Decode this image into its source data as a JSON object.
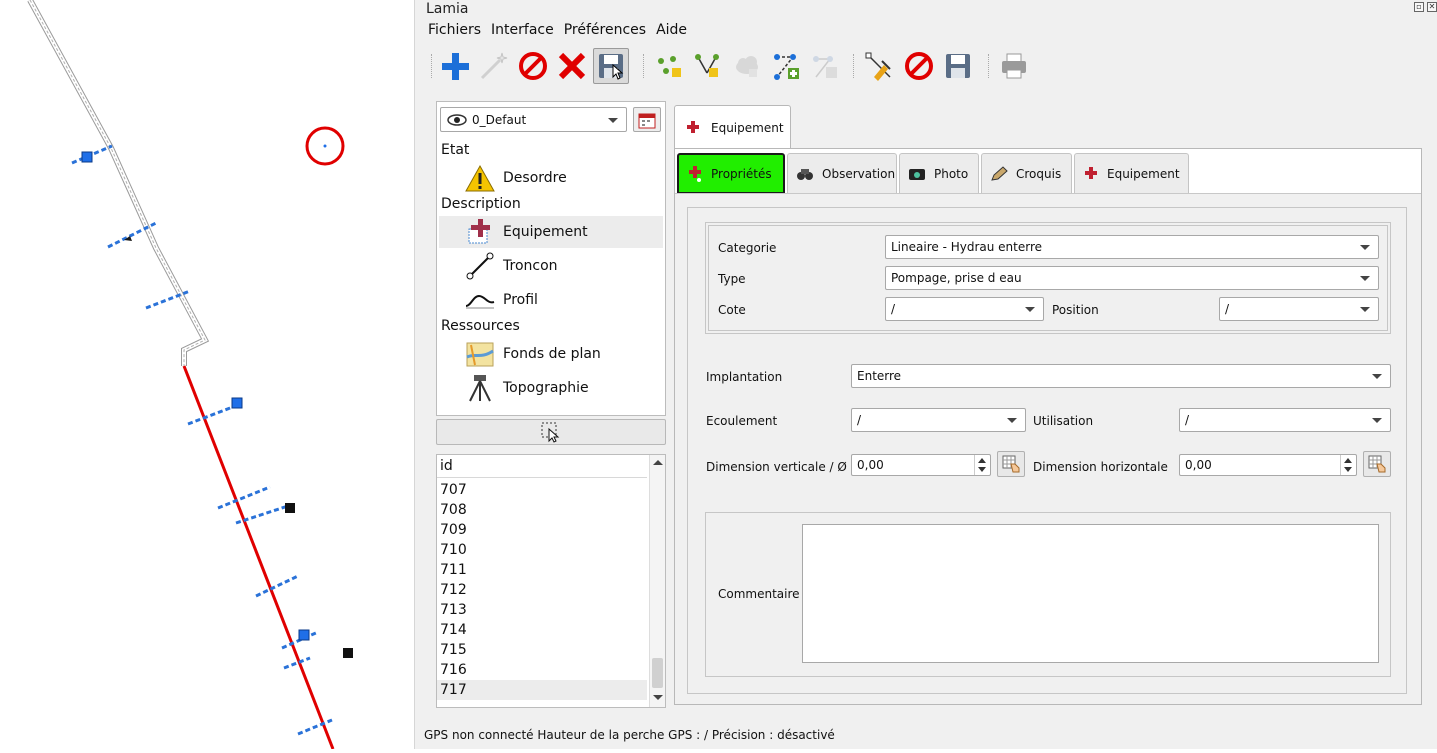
{
  "window": {
    "title": "Lamia"
  },
  "menu": [
    "Fichiers",
    "Interface",
    "Préférences",
    "Aide"
  ],
  "toolbar": {
    "icons": [
      "add-icon",
      "magic-wand-icon",
      "cancel-icon",
      "delete-icon",
      "save-icon",
      "add-node-icon",
      "edit-node-icon",
      "cloud-icon",
      "add-line-node-icon",
      "line-graph-icon",
      "edit-geometry-icon",
      "cancel-icon",
      "save-icon",
      "print-icon"
    ]
  },
  "left": {
    "version_combo": "0_Defaut",
    "tree": {
      "etat": "Etat",
      "desordre": "Desordre",
      "description": "Description",
      "equipement": "Equipement",
      "troncon": "Troncon",
      "profil": "Profil",
      "ressources": "Ressources",
      "fonds_de_plan": "Fonds de plan",
      "topographie": "Topographie"
    },
    "list": {
      "header": "id",
      "rows": [
        "707",
        "708",
        "709",
        "710",
        "711",
        "712",
        "713",
        "714",
        "715",
        "716",
        "717"
      ]
    }
  },
  "form": {
    "outer_tab": "Equipement",
    "tabs": {
      "proprietes": "Propriétés",
      "observation": "Observation",
      "photo": "Photo",
      "croquis": "Croquis",
      "equipement": "Equipement"
    },
    "labels": {
      "categorie": "Categorie",
      "type": "Type",
      "cote": "Cote",
      "position": "Position",
      "implantation": "Implantation",
      "ecoulement": "Ecoulement",
      "utilisation": "Utilisation",
      "dim_v": "Dimension verticale / Ø",
      "dim_h": "Dimension horizontale",
      "commentaire": "Commentaire"
    },
    "values": {
      "categorie": "Lineaire - Hydrau enterre",
      "type": "Pompage, prise d eau",
      "cote": "/",
      "position": "/",
      "implantation": "Enterre",
      "ecoulement": "/",
      "utilisation": "/",
      "dim_v": "0,00",
      "dim_h": "0,00"
    }
  },
  "status": "GPS non connecté Hauteur de la perche GPS : / Précision : désactivé",
  "colors": {
    "active_tab": "#21ee00",
    "line_red": "#e00000",
    "marker_blue": "#1f6fe8",
    "hatch_blue": "#2a72d8"
  }
}
